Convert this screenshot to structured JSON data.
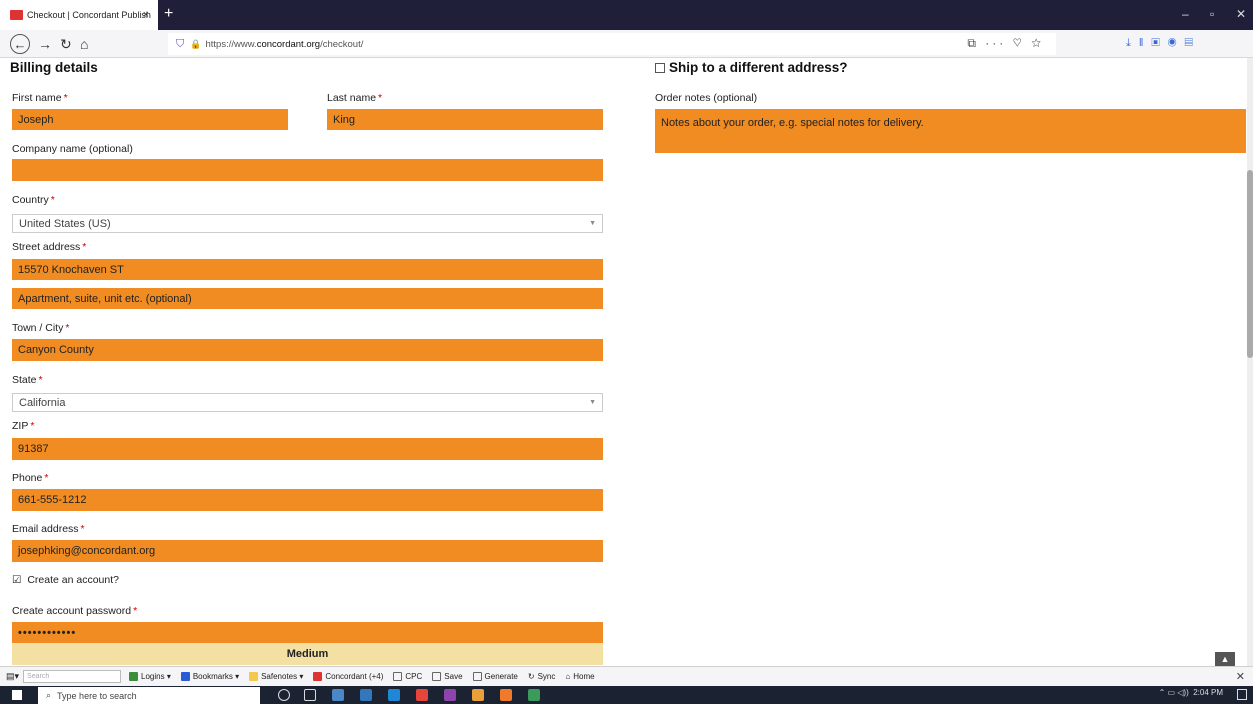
{
  "browser": {
    "tab_title": "Checkout | Concordant Publish",
    "tab_close": "×",
    "new_tab": "+",
    "url_prefix": "https://www.",
    "url_domain": "concordant.org",
    "url_path": "/checkout/",
    "url_actions": "⧉ ··· ♡ ☆"
  },
  "billing": {
    "heading": "Billing details",
    "first_name_label": "First name",
    "first_name_value": "Joseph",
    "last_name_label": "Last name",
    "last_name_value": "King",
    "company_label": "Company name (optional)",
    "company_value": "",
    "country_label": "Country",
    "country_value": "United States (US)",
    "street_label": "Street address",
    "street_value": "15570 Knochaven ST",
    "street2_placeholder": "Apartment, suite, unit etc. (optional)",
    "city_label": "Town / City",
    "city_value": "Canyon County",
    "state_label": "State",
    "state_value": "California",
    "zip_label": "ZIP",
    "zip_value": "91387",
    "phone_label": "Phone",
    "phone_value": "661-555-1212",
    "email_label": "Email address",
    "email_value": "josephking@concordant.org",
    "create_account_label": "Create an account?",
    "password_label": "Create account password",
    "password_value": "••••••••••••",
    "password_strength": "Medium",
    "required_mark": "*"
  },
  "shipping": {
    "ship_different_label": "Ship to a different address?",
    "order_notes_label": "Order notes (optional)",
    "order_notes_placeholder": "Notes about your order, e.g. special notes for delivery."
  },
  "bookmarks": {
    "search_placeholder": "Search",
    "items": [
      "Logins ▾",
      "Bookmarks ▾",
      "Safenotes ▾",
      "Concordant (+4)",
      "CPC",
      "Save",
      "Generate",
      "Sync",
      "Home"
    ]
  },
  "taskbar": {
    "search_placeholder": "Type here to search",
    "time": "2:04 PM"
  },
  "colors": {
    "field_fill": "#f08c22",
    "strength_fill": "#f5e0a3"
  }
}
